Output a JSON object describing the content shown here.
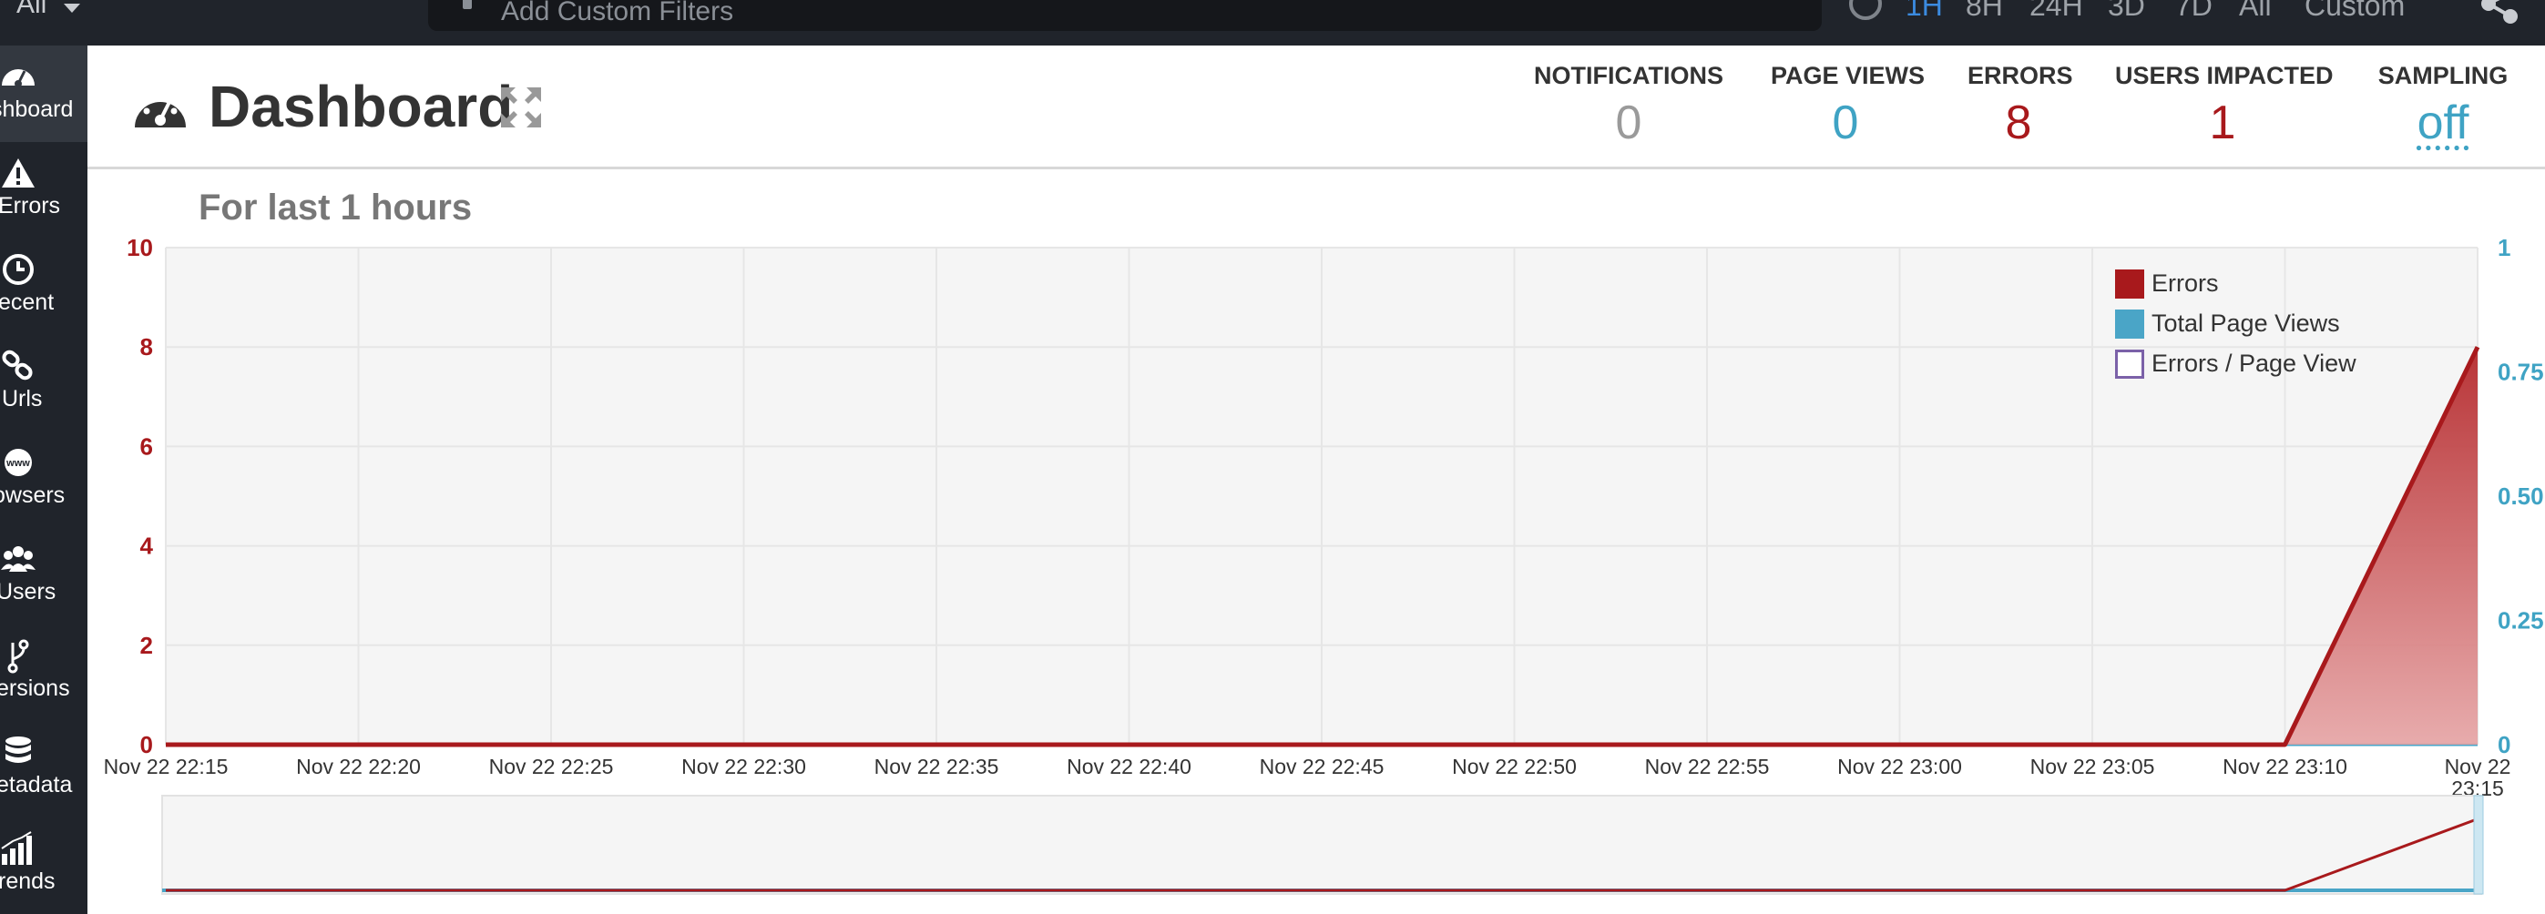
{
  "topbar": {
    "environment": "All",
    "filter_placeholder": "Add Custom Filters",
    "time_ranges": [
      "1H",
      "8H",
      "24H",
      "3D",
      "7D",
      "All",
      "Custom"
    ],
    "active_range": "1H"
  },
  "sidebar": {
    "items": [
      {
        "label": "Dashboard",
        "visible_label": "shboard",
        "icon": "dashboard-icon",
        "active": true
      },
      {
        "label": "Errors",
        "visible_label": "Errors",
        "icon": "warning-icon"
      },
      {
        "label": "Recent",
        "visible_label": "ecent",
        "icon": "clock-icon"
      },
      {
        "label": "Urls",
        "visible_label": "Urls",
        "icon": "link-icon"
      },
      {
        "label": "Browsers",
        "visible_label": "owsers",
        "icon": "www-icon"
      },
      {
        "label": "Users",
        "visible_label": "Users",
        "icon": "users-icon"
      },
      {
        "label": "Versions",
        "visible_label": "ersions",
        "icon": "branch-icon"
      },
      {
        "label": "Metadata",
        "visible_label": "etadata",
        "icon": "database-icon"
      },
      {
        "label": "Trends",
        "visible_label": "rends",
        "icon": "trends-icon"
      }
    ]
  },
  "header": {
    "title": "Dashboard",
    "stats": [
      {
        "label": "NOTIFICATIONS",
        "value": "0",
        "color": "#9a9a9a"
      },
      {
        "label": "PAGE VIEWS",
        "value": "0",
        "color": "#3fa3c4"
      },
      {
        "label": "ERRORS",
        "value": "8",
        "color": "#a8191c"
      },
      {
        "label": "USERS IMPACTED",
        "value": "1",
        "color": "#a8191c"
      },
      {
        "label": "SAMPLING",
        "value": "off",
        "color": "#3fa3c4"
      }
    ]
  },
  "chart_data": {
    "type": "area",
    "title": "For last 1 hours",
    "x": [
      "Nov 22 22:15",
      "Nov 22 22:20",
      "Nov 22 22:25",
      "Nov 22 22:30",
      "Nov 22 22:35",
      "Nov 22 22:40",
      "Nov 22 22:45",
      "Nov 22 22:50",
      "Nov 22 22:55",
      "Nov 22 23:00",
      "Nov 22 23:05",
      "Nov 22 23:10",
      "Nov 22 23:15"
    ],
    "x_tick_labels": [
      "Nov 22 22:15",
      "Nov 22 22:20",
      "Nov 22 22:25",
      "Nov 22 22:30",
      "Nov 22 22:35",
      "Nov 22 22:40",
      "Nov 22 22:45",
      "Nov 22 22:50",
      "Nov 22 22:55",
      "Nov 22 23:00",
      "Nov 22 23:05",
      "Nov 22 23:10",
      "Nov 22 23:15"
    ],
    "y_left": {
      "ticks": [
        "0",
        "2",
        "4",
        "6",
        "8",
        "10"
      ],
      "range": [
        0,
        10
      ],
      "color": "#a8191c"
    },
    "y_right": {
      "ticks": [
        "0",
        "0.25",
        "0.50",
        "0.75",
        "1"
      ],
      "range": [
        0,
        1
      ],
      "color": "#3fa3c4"
    },
    "series": [
      {
        "name": "Errors",
        "axis": "left",
        "color": "#a8191c",
        "values": [
          0,
          0,
          0,
          0,
          0,
          0,
          0,
          0,
          0,
          0,
          0,
          0,
          8
        ]
      },
      {
        "name": "Total Page Views",
        "axis": "right",
        "color": "#4aa5c7",
        "values": [
          0,
          0,
          0,
          0,
          0,
          0,
          0,
          0,
          0,
          0,
          0,
          0,
          0
        ]
      },
      {
        "name": "Errors / Page View",
        "axis": "right",
        "color": "#7b61a8",
        "values": []
      }
    ],
    "legend_position": "top-right",
    "grid": true
  }
}
